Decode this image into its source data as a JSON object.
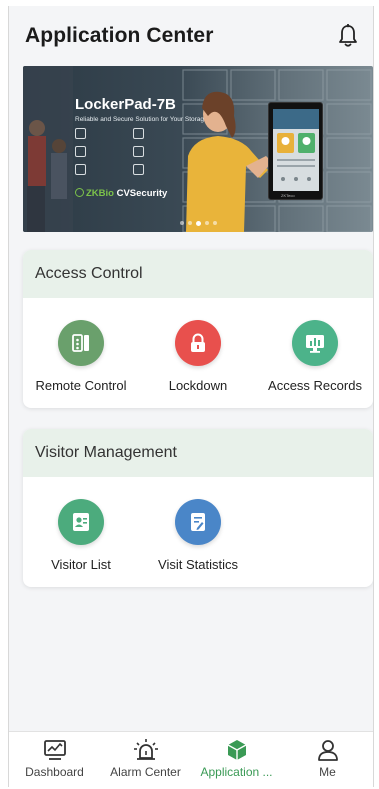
{
  "header": {
    "title": "Application Center"
  },
  "banner": {
    "title": "LockerPad-7B",
    "subtitle": "Reliable and Secure Solution for Your Storage",
    "brand_prefix": "ZKBio",
    "brand_suffix": " CVSecurity",
    "slide_count": 5,
    "active_slide": 2
  },
  "sections": [
    {
      "title": "Access Control",
      "items": [
        {
          "label": "Remote Control",
          "icon": "remote-control-icon",
          "color": "#6aa06c"
        },
        {
          "label": "Lockdown",
          "icon": "lock-icon",
          "color": "#e8504d"
        },
        {
          "label": "Access Records",
          "icon": "monitor-chart-icon",
          "color": "#4cb38a"
        }
      ]
    },
    {
      "title": "Visitor Management",
      "items": [
        {
          "label": "Visitor List",
          "icon": "visitor-card-icon",
          "color": "#4cab7d"
        },
        {
          "label": "Visit Statistics",
          "icon": "document-edit-icon",
          "color": "#4a86c8"
        }
      ]
    }
  ],
  "nav": [
    {
      "label": "Dashboard",
      "icon": "dashboard-icon"
    },
    {
      "label": "Alarm Center",
      "icon": "alarm-icon"
    },
    {
      "label": "Application ...",
      "icon": "application-cube-icon",
      "active": true
    },
    {
      "label": "Me",
      "icon": "user-icon"
    }
  ],
  "colors": {
    "accent": "#3a9a55",
    "section_header_bg": "#e8f1ea"
  }
}
